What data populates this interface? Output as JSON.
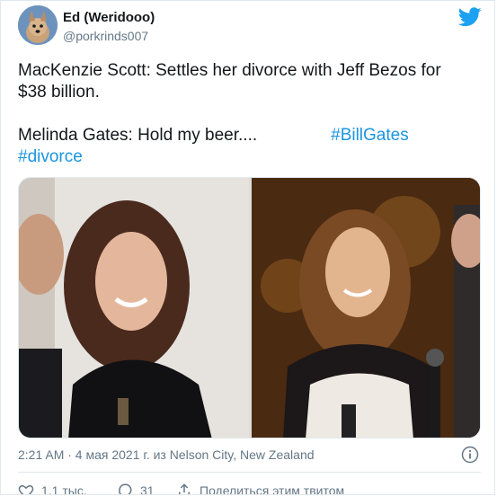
{
  "author": {
    "display_name": "Ed (Weridooo)",
    "handle": "@porkrinds007",
    "avatar_icon": "dog-avatar"
  },
  "brand_icon": "twitter-bird-icon",
  "tweet": {
    "line1": "MacKenzie Scott: Settles her divorce with Jeff Bezos for",
    "line2": "$38 billion.",
    "line3_text": "Melinda Gates: Hold my beer....",
    "hashtag1": "#BillGates",
    "hashtag2": "#divorce"
  },
  "meta": {
    "timestamp": "2:21 AM · 4 мая 2021 г. из Nelson City, New Zealand"
  },
  "actions": {
    "likes": "1,1 тыс.",
    "replies": "31",
    "share_label": "Поделиться этим твитом"
  },
  "colors": {
    "brand": "#1da1f2",
    "hashtag": "#1b95e0",
    "secondary_text": "#657786"
  }
}
